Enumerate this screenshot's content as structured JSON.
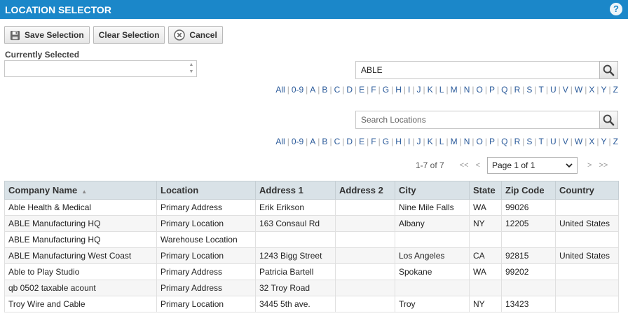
{
  "window": {
    "title": "LOCATION SELECTOR",
    "help": "?"
  },
  "toolbar": {
    "save_label": "Save Selection",
    "clear_label": "Clear Selection",
    "cancel_label": "Cancel"
  },
  "current": {
    "label": "Currently Selected",
    "value": ""
  },
  "company_search": {
    "value": "ABLE",
    "placeholder": ""
  },
  "location_search": {
    "value": "",
    "placeholder": "Search Locations"
  },
  "letters": [
    "All",
    "0-9",
    "A",
    "B",
    "C",
    "D",
    "E",
    "F",
    "G",
    "H",
    "I",
    "J",
    "K",
    "L",
    "M",
    "N",
    "O",
    "P",
    "Q",
    "R",
    "S",
    "T",
    "U",
    "V",
    "W",
    "X",
    "Y",
    "Z"
  ],
  "pager": {
    "count": "1-7 of 7",
    "first": "<<",
    "prev": "<",
    "page": "Page 1 of 1",
    "next": ">",
    "last": ">>"
  },
  "table": {
    "columns": [
      "Company Name",
      "Location",
      "Address 1",
      "Address 2",
      "City",
      "State",
      "Zip Code",
      "Country"
    ],
    "sort_indicator": "▲",
    "rows": [
      [
        "Able Health & Medical",
        "Primary Address",
        "Erik Erikson",
        "",
        "Nine Mile Falls",
        "WA",
        "99026",
        ""
      ],
      [
        "ABLE Manufacturing HQ",
        "Primary Location",
        "163 Consaul Rd",
        "",
        "Albany",
        "NY",
        "12205",
        "United States"
      ],
      [
        "ABLE Manufacturing HQ",
        "Warehouse Location",
        "",
        "",
        "",
        "",
        "",
        ""
      ],
      [
        "ABLE Manufacturing West Coast",
        "Primary Location",
        "1243 Bigg Street",
        "",
        "Los Angeles",
        "CA",
        "92815",
        "United States"
      ],
      [
        "Able to Play Studio",
        "Primary Address",
        "Patricia Bartell",
        "",
        "Spokane",
        "WA",
        "99202",
        ""
      ],
      [
        "qb 0502 taxable acount",
        "Primary Address",
        "32 Troy Road",
        "",
        "",
        "",
        "",
        ""
      ],
      [
        "Troy Wire and Cable",
        "Primary Location",
        "3445 5th ave.",
        "",
        "Troy",
        "NY",
        "13423",
        ""
      ]
    ]
  }
}
